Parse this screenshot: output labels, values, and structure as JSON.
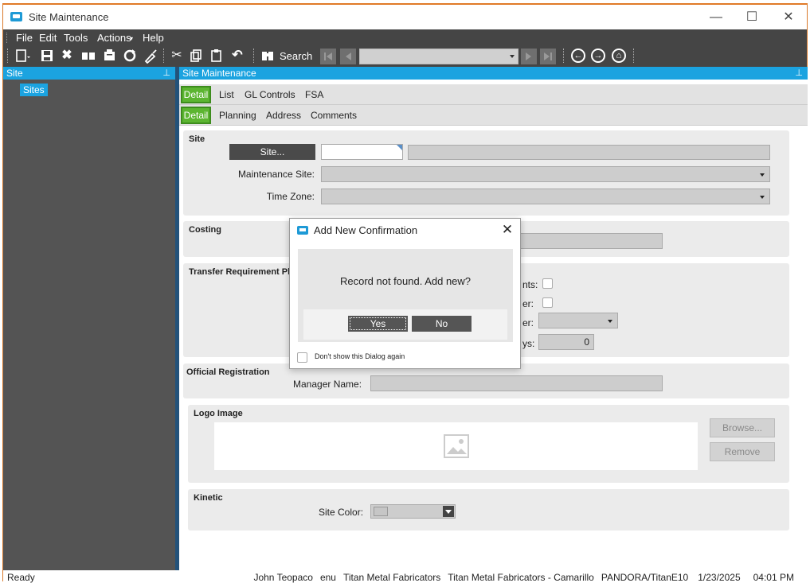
{
  "window": {
    "title": "Site Maintenance",
    "minimize": "—",
    "maximize": "☐",
    "close": "✕"
  },
  "menu": {
    "items": [
      "File",
      "Edit",
      "Tools",
      "Actions",
      "Help"
    ]
  },
  "toolbar": {
    "search_label": "Search",
    "record_combo": ""
  },
  "left_pane": {
    "header": "Site",
    "tree_item": "Sites",
    "pin": "📌"
  },
  "main_pane": {
    "header": "Site Maintenance",
    "tabs_top": {
      "active": "Detail",
      "others": [
        "List",
        "GL Controls",
        "FSA"
      ]
    },
    "tabs_sub": {
      "active": "Detail",
      "others": [
        "Planning",
        "Address",
        "Comments"
      ]
    }
  },
  "site_group": {
    "title": "Site",
    "site_button": "Site...",
    "site_id_value": "",
    "site_name_value": "",
    "maintenance_site_label": "Maintenance Site:",
    "maintenance_site_value": "",
    "time_zone_label": "Time Zone:",
    "time_zone_value": ""
  },
  "costing_group": {
    "title": "Costing"
  },
  "transfer_group": {
    "title": "Transfer Requirement Pl",
    "label1": "nts:",
    "label2": "er:",
    "label3": "er:",
    "label4": "ys:",
    "days_value": "0"
  },
  "official_group": {
    "title": "Official Registration",
    "manager_label": "Manager Name:",
    "manager_value": ""
  },
  "logo_group": {
    "title": "Logo Image",
    "browse": "Browse...",
    "remove": "Remove"
  },
  "kinetic_group": {
    "title": "Kinetic",
    "site_color_label": "Site Color:"
  },
  "dialog": {
    "title": "Add New Confirmation",
    "message": "Record not found.  Add new?",
    "yes": "Yes",
    "no": "No",
    "dont_show": "Don't show this Dialog again"
  },
  "status": {
    "left": "Ready",
    "user": "John Teopaco",
    "lang": "enu",
    "company": "Titan Metal Fabricators",
    "site": "Titan Metal Fabricators - Camarillo",
    "server": "PANDORA/TitanE10",
    "date": "1/23/2025",
    "time": "04:01 PM"
  },
  "colors": {
    "accent": "#1ba3e0",
    "active_tab": "#5cb531",
    "dark_bar": "#454545",
    "title_border": "#e07a28"
  }
}
